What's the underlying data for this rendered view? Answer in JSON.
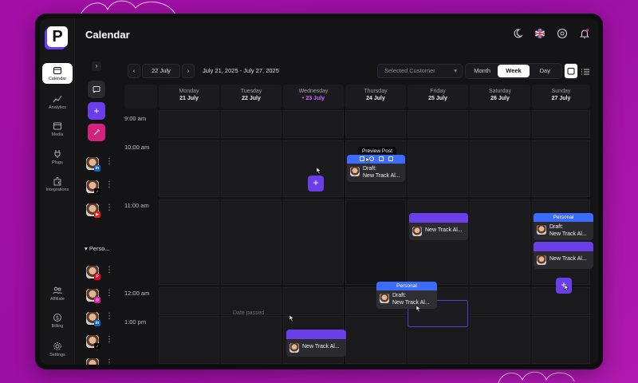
{
  "app": {
    "logo_letter": "P",
    "page_title": "Calendar"
  },
  "nav": [
    {
      "label": "Calendar",
      "icon": "calendar-icon",
      "active": true
    },
    {
      "label": "Analytics",
      "icon": "analytics-icon"
    },
    {
      "label": "Media",
      "icon": "media-icon"
    },
    {
      "label": "Plugs",
      "icon": "plug-icon"
    },
    {
      "label": "Integrations",
      "icon": "puzzle-icon"
    },
    {
      "label": "Affiliate",
      "icon": "affiliate-icon"
    },
    {
      "label": "Billing",
      "icon": "billing-icon"
    },
    {
      "label": "Settings",
      "icon": "gear-icon"
    }
  ],
  "toolbar": {
    "prev": "‹",
    "next": "›",
    "current_date": "22 July",
    "range": "July 21, 2025 - July 27, 2025",
    "customer_placeholder": "Selected Customer",
    "views": [
      "Month",
      "Week",
      "Day"
    ],
    "active_view": "Week"
  },
  "group": {
    "label": "Perso..."
  },
  "days": [
    {
      "name": "Monday",
      "date": "21 July"
    },
    {
      "name": "Tuesday",
      "date": "22 July"
    },
    {
      "name": "Wednesday",
      "date": "• 23 July",
      "today": true
    },
    {
      "name": "Thursday",
      "date": "24 July"
    },
    {
      "name": "Friday",
      "date": "25 July"
    },
    {
      "name": "Saturday",
      "date": "26 July"
    },
    {
      "name": "Sunday",
      "date": "27 July"
    }
  ],
  "times": [
    "9:00 am",
    "10:00 am",
    "11:00 am",
    "12:00 am",
    "1:00 pm"
  ],
  "past_label": "Date passed",
  "tooltip": "Preview Post",
  "events": {
    "thu_draft": {
      "line1": "Draft:",
      "line2": "New Track Al..."
    },
    "fri_track": {
      "text": "New Track Al..."
    },
    "sun_personal": {
      "bar": "Personal",
      "line1": "Draft:",
      "line2": "New Track Al..."
    },
    "sun_track": {
      "text": "New Track Al..."
    },
    "drag_personal": {
      "bar": "Personal",
      "line1": "Draft:",
      "line2": "New Track Al..."
    },
    "wed_track": {
      "text": "New Track Al..."
    }
  },
  "colors": {
    "accent": "#6a3ee8",
    "preview_blue": "#3b6bff",
    "background": "#a30fa6"
  }
}
